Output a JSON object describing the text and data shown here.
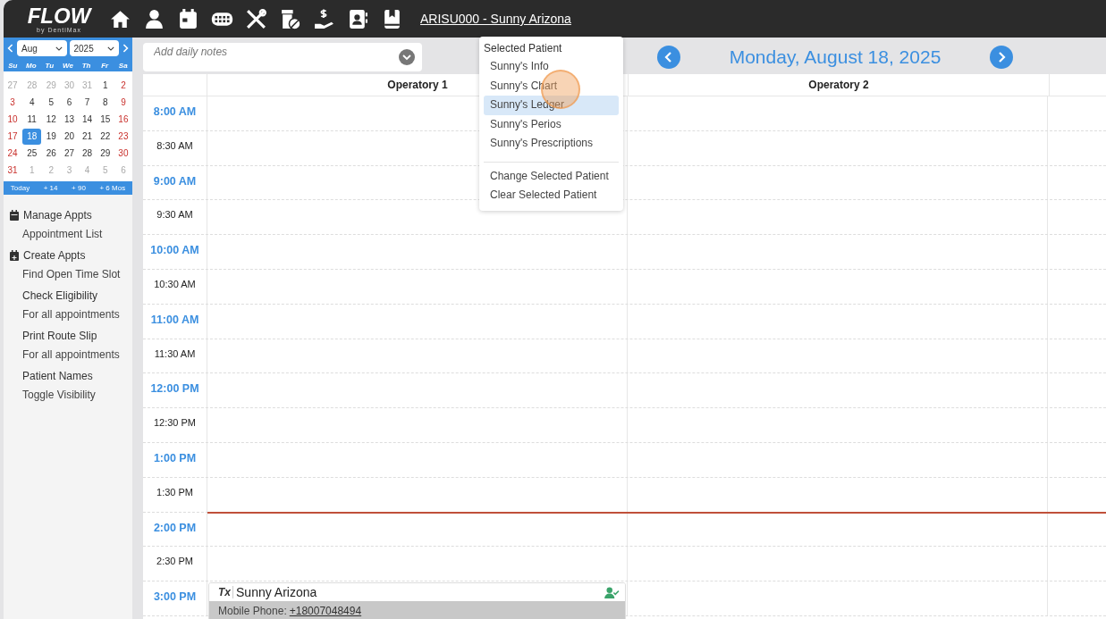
{
  "topbar": {
    "logo": "FLOW",
    "logo_sub": "by DentiMax",
    "patient_link": "ARISU000 - Sunny Arizona"
  },
  "calendar": {
    "month": "Aug",
    "year": "2025",
    "weekdays": [
      "Su",
      "Mo",
      "Tu",
      "We",
      "Th",
      "Fr",
      "Sa"
    ],
    "days": [
      {
        "label": "27",
        "kind": "muted",
        "selected": false
      },
      {
        "label": "28",
        "kind": "muted",
        "selected": false
      },
      {
        "label": "29",
        "kind": "muted",
        "selected": false
      },
      {
        "label": "30",
        "kind": "muted",
        "selected": false
      },
      {
        "label": "31",
        "kind": "muted",
        "selected": false
      },
      {
        "label": "1",
        "kind": "normal",
        "selected": false
      },
      {
        "label": "2",
        "kind": "weekend",
        "selected": false
      },
      {
        "label": "3",
        "kind": "weekend",
        "selected": false
      },
      {
        "label": "4",
        "kind": "normal",
        "selected": false
      },
      {
        "label": "5",
        "kind": "normal",
        "selected": false
      },
      {
        "label": "6",
        "kind": "normal",
        "selected": false
      },
      {
        "label": "7",
        "kind": "normal",
        "selected": false
      },
      {
        "label": "8",
        "kind": "normal",
        "selected": false
      },
      {
        "label": "9",
        "kind": "weekend",
        "selected": false
      },
      {
        "label": "10",
        "kind": "weekend",
        "selected": false
      },
      {
        "label": "11",
        "kind": "normal",
        "selected": false
      },
      {
        "label": "12",
        "kind": "normal",
        "selected": false
      },
      {
        "label": "13",
        "kind": "normal",
        "selected": false
      },
      {
        "label": "14",
        "kind": "normal",
        "selected": false
      },
      {
        "label": "15",
        "kind": "normal",
        "selected": false
      },
      {
        "label": "16",
        "kind": "weekend",
        "selected": false
      },
      {
        "label": "17",
        "kind": "weekend",
        "selected": false
      },
      {
        "label": "18",
        "kind": "normal",
        "selected": true
      },
      {
        "label": "19",
        "kind": "normal",
        "selected": false
      },
      {
        "label": "20",
        "kind": "normal",
        "selected": false
      },
      {
        "label": "21",
        "kind": "normal",
        "selected": false
      },
      {
        "label": "22",
        "kind": "normal",
        "selected": false
      },
      {
        "label": "23",
        "kind": "weekend",
        "selected": false
      },
      {
        "label": "24",
        "kind": "weekend",
        "selected": false
      },
      {
        "label": "25",
        "kind": "normal",
        "selected": false
      },
      {
        "label": "26",
        "kind": "normal",
        "selected": false
      },
      {
        "label": "27",
        "kind": "normal",
        "selected": false
      },
      {
        "label": "28",
        "kind": "normal",
        "selected": false
      },
      {
        "label": "29",
        "kind": "normal",
        "selected": false
      },
      {
        "label": "30",
        "kind": "weekend",
        "selected": false
      },
      {
        "label": "31",
        "kind": "weekend",
        "selected": false
      },
      {
        "label": "1",
        "kind": "muted",
        "selected": false
      },
      {
        "label": "2",
        "kind": "muted",
        "selected": false
      },
      {
        "label": "3",
        "kind": "muted",
        "selected": false
      },
      {
        "label": "4",
        "kind": "muted",
        "selected": false
      },
      {
        "label": "5",
        "kind": "muted",
        "selected": false
      },
      {
        "label": "6",
        "kind": "muted",
        "selected": false
      }
    ],
    "shortcuts": [
      "Today",
      "+ 14",
      "+ 90",
      "+ 6 Mos"
    ]
  },
  "sidebar": {
    "items": [
      {
        "title": "Manage Appts",
        "subtitle": "Appointment List",
        "kind": "calendar"
      },
      {
        "title": "Create Appts",
        "subtitle": "Find Open Time Slot",
        "kind": "calendar-plus"
      },
      {
        "title": "Check Eligibility",
        "subtitle": "For all appointments"
      },
      {
        "title": "Print Route Slip",
        "subtitle": "For all appointments"
      },
      {
        "title": "Patient Names",
        "subtitle": "Toggle Visibility"
      }
    ]
  },
  "notes": {
    "placeholder": "Add daily notes"
  },
  "date_title": "Monday, August 18, 2025",
  "columns": [
    "Operatory 1",
    "Operatory 2"
  ],
  "slots": [
    {
      "time": "8:00 AM",
      "kind": "hour"
    },
    {
      "time": "8:30 AM",
      "kind": "half"
    },
    {
      "time": "9:00 AM",
      "kind": "hour"
    },
    {
      "time": "9:30 AM",
      "kind": "half"
    },
    {
      "time": "10:00 AM",
      "kind": "hour"
    },
    {
      "time": "10:30 AM",
      "kind": "half"
    },
    {
      "time": "11:00 AM",
      "kind": "hour"
    },
    {
      "time": "11:30 AM",
      "kind": "half"
    },
    {
      "time": "12:00 PM",
      "kind": "hour"
    },
    {
      "time": "12:30 PM",
      "kind": "half"
    },
    {
      "time": "1:00 PM",
      "kind": "hour"
    },
    {
      "time": "1:30 PM",
      "kind": "half"
    },
    {
      "time": "2:00 PM",
      "kind": "hour",
      "now": true
    },
    {
      "time": "2:30 PM",
      "kind": "half"
    },
    {
      "time": "3:00 PM",
      "kind": "hour",
      "appointment": {
        "badge": "Tx",
        "patient": "Sunny Arizona",
        "phone_label": "Mobile Phone:",
        "phone": "+18007048494",
        "confirmed": true
      }
    }
  ],
  "patient_menu": {
    "heading": "Selected Patient",
    "items": [
      {
        "label": "Sunny's Info",
        "selected": false
      },
      {
        "label": "Sunny's Chart",
        "selected": false
      },
      {
        "label": "Sunny's Ledger",
        "selected": true
      },
      {
        "label": "Sunny's Perios",
        "selected": false
      },
      {
        "label": "Sunny's Prescriptions",
        "selected": false
      }
    ],
    "actions": [
      "Change Selected Patient",
      "Clear Selected Patient"
    ]
  }
}
